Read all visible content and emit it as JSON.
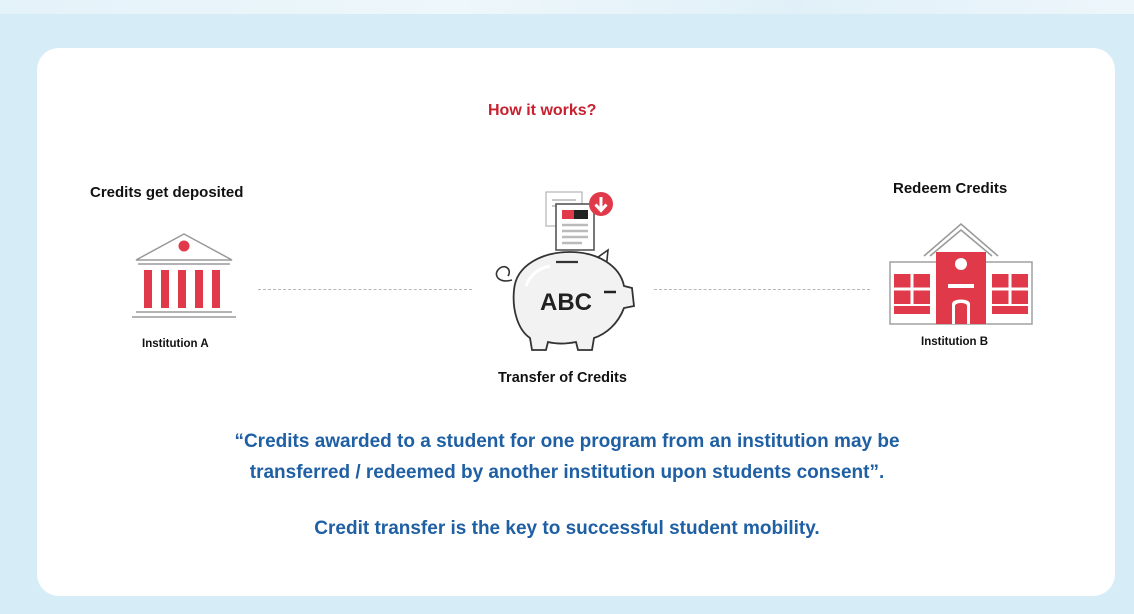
{
  "title": "How it works?",
  "left": {
    "heading": "Credits get deposited",
    "caption": "Institution A",
    "icon": "institution-building-icon"
  },
  "center": {
    "piggy_label": "ABC",
    "caption": "Transfer of Credits",
    "icon": "piggy-bank-icon",
    "document_icon": "download-document-icon"
  },
  "right": {
    "heading": "Redeem Credits",
    "caption": "Institution B",
    "icon": "school-building-icon"
  },
  "quote_line1": "“Credits awarded to a student for one program from an institution may be",
  "quote_line2": "transferred / redeemed by another institution upon students consent”.",
  "tagline": "Credit transfer is the key to successful student mobility.",
  "colors": {
    "background": "#d6ecf6",
    "accent_red": "#e03a4a",
    "title_red": "#c8202f",
    "text_blue": "#1f5fa3"
  }
}
